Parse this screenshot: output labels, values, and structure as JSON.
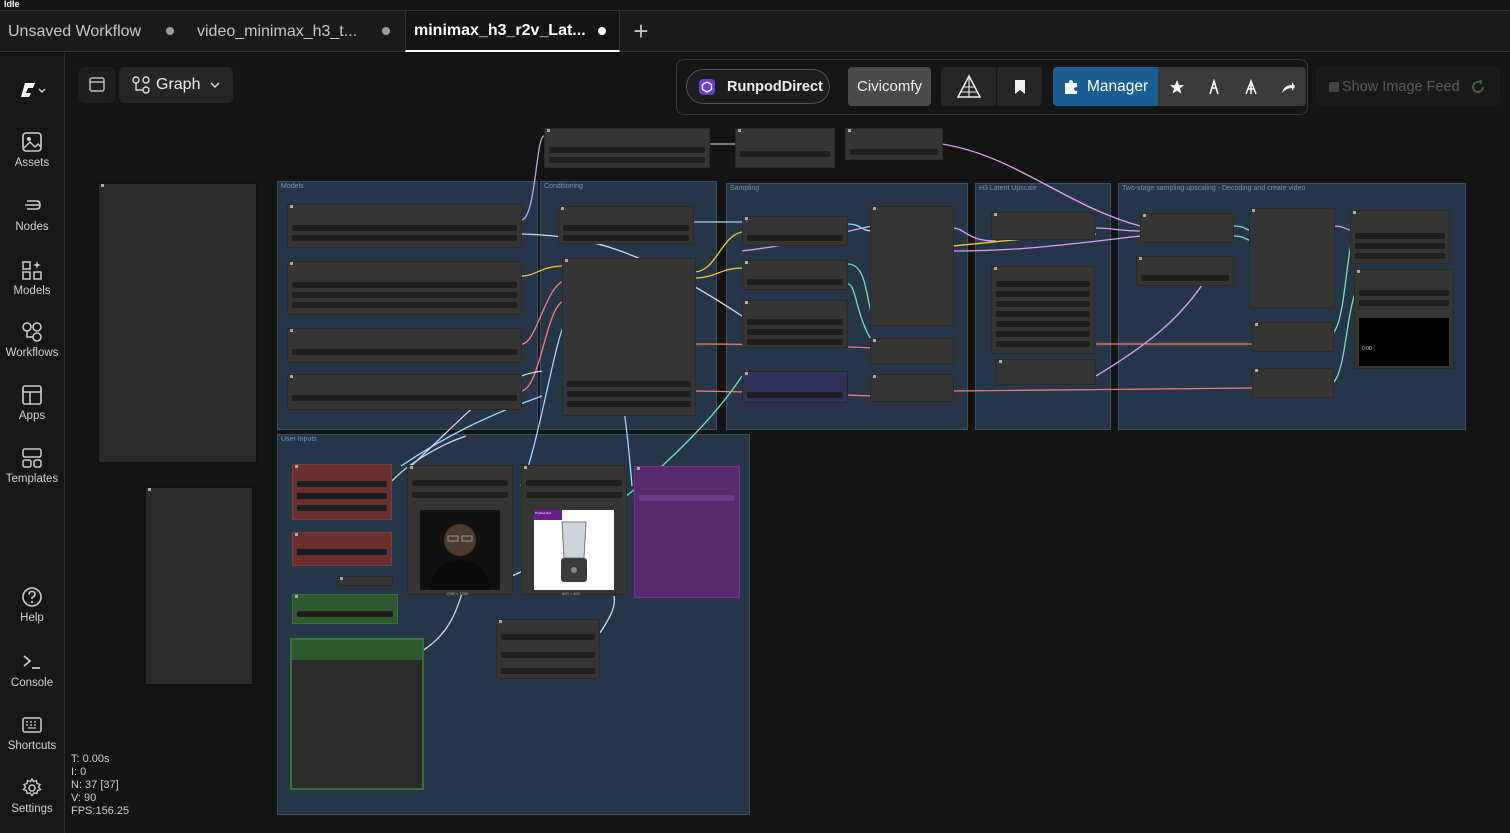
{
  "status_text": "Idle",
  "tabs": [
    {
      "label": "Unsaved Workflow",
      "active": false
    },
    {
      "label": "video_minimax_h3_t...",
      "active": false
    },
    {
      "label": "minimax_h3_r2v_Lat...",
      "active": true
    }
  ],
  "sidebar": {
    "items": [
      {
        "label": "Assets",
        "icon": "image-icon"
      },
      {
        "label": "Nodes",
        "icon": "nodes-icon"
      },
      {
        "label": "Models",
        "icon": "models-icon"
      },
      {
        "label": "Workflows",
        "icon": "workflow-icon"
      },
      {
        "label": "Apps",
        "icon": "apps-icon"
      },
      {
        "label": "Templates",
        "icon": "templates-icon"
      },
      {
        "label": "Help",
        "icon": "help-icon"
      },
      {
        "label": "Console",
        "icon": "console-icon"
      },
      {
        "label": "Shortcuts",
        "icon": "keyboard-icon"
      },
      {
        "label": "Settings",
        "icon": "gear-icon"
      }
    ]
  },
  "graph_toolbar": {
    "mode_label": "Graph"
  },
  "toolbar": {
    "runpod_label": "RunpodDirect",
    "civicomfy_label": "Civicomfy",
    "manager_label": "Manager",
    "image_feed_label": "Show Image Feed"
  },
  "canvas": {
    "groups": [
      "Models",
      "Conditioning",
      "Sampling",
      "H3 Latent Upscale",
      "Two-stage sampling upscaling - Decoding and create video",
      "User Inputs"
    ],
    "image_sizes": [
      "1280 × 1280",
      "800 × 800"
    ],
    "product_badge": "Product Ref",
    "video_time": "0:00"
  },
  "stats": {
    "t": "T: 0.00s",
    "i": "I: 0",
    "n": "N: 37 [37]",
    "v": "V: 90",
    "fps": "FPS:156.25"
  },
  "colors": {
    "accent_manager": "#1b5e91",
    "group_fill": "#263646",
    "red_node": "#6a3030",
    "green_node": "#2f5a2f",
    "purple_node": "#5a2a6e"
  }
}
